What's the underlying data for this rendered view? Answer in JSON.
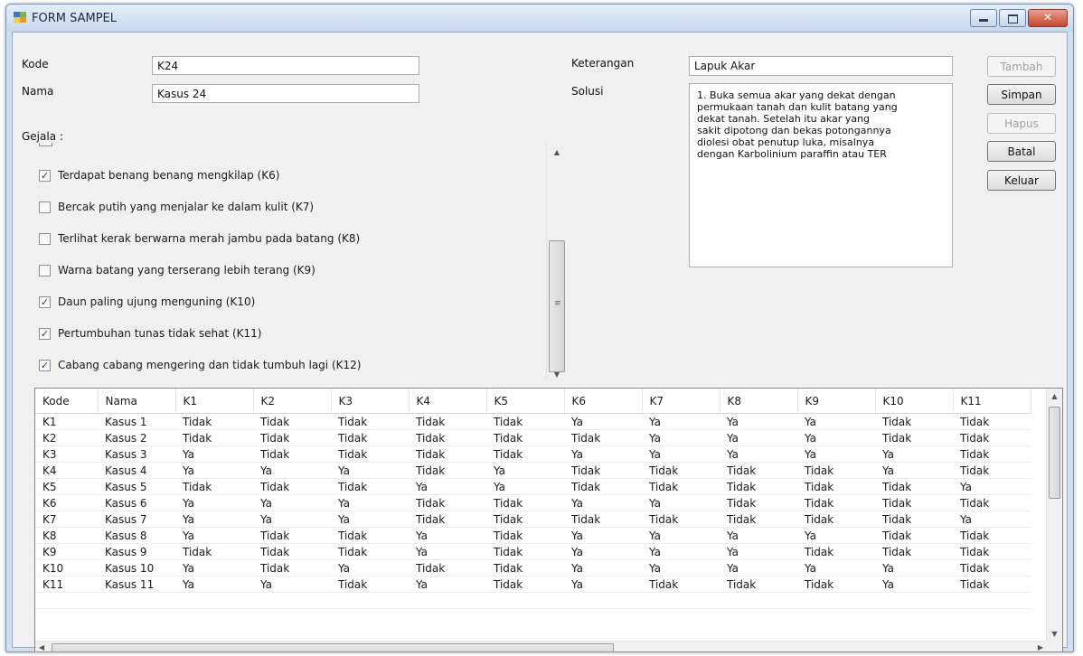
{
  "window": {
    "title": "FORM SAMPEL"
  },
  "form": {
    "kode_label": "Kode",
    "kode_value": "K24",
    "nama_label": "Nama",
    "nama_value": "Kasus 24",
    "gejala_label": "Gejala :",
    "keterangan_label": "Keterangan",
    "keterangan_value": "Lapuk Akar",
    "solusi_label": "Solusi",
    "solusi_value": "1. Buka semua akar yang dekat dengan\npermukaan tanah dan kulit batang yang\ndekat tanah. Setelah itu akar yang\nsakit dipotong dan bekas potongannya\ndiolesi obat penutup luka, misalnya\ndengan Karbolinium paraffin atau TER"
  },
  "buttons": {
    "tambah": "Tambah",
    "simpan": "Simpan",
    "hapus": "Hapus",
    "batal": "Batal",
    "keluar": "Keluar"
  },
  "symptoms": [
    {
      "label": "Terdapat benang benang mengkilap (K6)",
      "checked": true
    },
    {
      "label": "Bercak putih yang menjalar ke dalam kulit (K7)",
      "checked": false
    },
    {
      "label": "Terlihat kerak berwarna merah jambu pada batang (K8)",
      "checked": false
    },
    {
      "label": "Warna batang yang terserang lebih terang (K9)",
      "checked": false
    },
    {
      "label": "Daun paling ujung menguning (K10)",
      "checked": true
    },
    {
      "label": "Pertumbuhan tunas tidak sehat (K11)",
      "checked": true
    },
    {
      "label": "Cabang cabang mengering dan tidak tumbuh lagi  (K12)",
      "checked": true
    }
  ],
  "grid": {
    "columns": [
      "Kode",
      "Nama",
      "K1",
      "K2",
      "K3",
      "K4",
      "K5",
      "K6",
      "K7",
      "K8",
      "K9",
      "K10",
      "K11"
    ],
    "rows": [
      [
        "K1",
        "Kasus 1",
        "Tidak",
        "Tidak",
        "Tidak",
        "Tidak",
        "Tidak",
        "Ya",
        "Ya",
        "Ya",
        "Ya",
        "Tidak",
        "Tidak"
      ],
      [
        "K2",
        "Kasus 2",
        "Tidak",
        "Tidak",
        "Tidak",
        "Tidak",
        "Tidak",
        "Tidak",
        "Ya",
        "Ya",
        "Ya",
        "Tidak",
        "Tidak"
      ],
      [
        "K3",
        "Kasus 3",
        "Ya",
        "Tidak",
        "Tidak",
        "Tidak",
        "Tidak",
        "Ya",
        "Ya",
        "Ya",
        "Ya",
        "Ya",
        "Tidak"
      ],
      [
        "K4",
        "Kasus 4",
        "Ya",
        "Ya",
        "Ya",
        "Tidak",
        "Ya",
        "Tidak",
        "Tidak",
        "Tidak",
        "Tidak",
        "Ya",
        "Tidak"
      ],
      [
        "K5",
        "Kasus 5",
        "Tidak",
        "Tidak",
        "Tidak",
        "Ya",
        "Ya",
        "Tidak",
        "Tidak",
        "Tidak",
        "Tidak",
        "Tidak",
        "Ya"
      ],
      [
        "K6",
        "Kasus 6",
        "Ya",
        "Ya",
        "Ya",
        "Tidak",
        "Tidak",
        "Ya",
        "Ya",
        "Tidak",
        "Tidak",
        "Tidak",
        "Tidak"
      ],
      [
        "K7",
        "Kasus 7",
        "Ya",
        "Ya",
        "Ya",
        "Tidak",
        "Tidak",
        "Tidak",
        "Tidak",
        "Tidak",
        "Tidak",
        "Tidak",
        "Ya"
      ],
      [
        "K8",
        "Kasus 8",
        "Ya",
        "Tidak",
        "Tidak",
        "Ya",
        "Tidak",
        "Ya",
        "Ya",
        "Ya",
        "Ya",
        "Tidak",
        "Tidak"
      ],
      [
        "K9",
        "Kasus 9",
        "Tidak",
        "Tidak",
        "Tidak",
        "Ya",
        "Tidak",
        "Ya",
        "Ya",
        "Ya",
        "Tidak",
        "Tidak",
        "Tidak"
      ],
      [
        "K10",
        "Kasus 10",
        "Ya",
        "Tidak",
        "Ya",
        "Tidak",
        "Tidak",
        "Ya",
        "Ya",
        "Ya",
        "Ya",
        "Ya",
        "Tidak"
      ],
      [
        "K11",
        "Kasus 11",
        "Ya",
        "Ya",
        "Tidak",
        "Ya",
        "Tidak",
        "Ya",
        "Tidak",
        "Tidak",
        "Tidak",
        "Ya",
        "Tidak"
      ]
    ]
  }
}
